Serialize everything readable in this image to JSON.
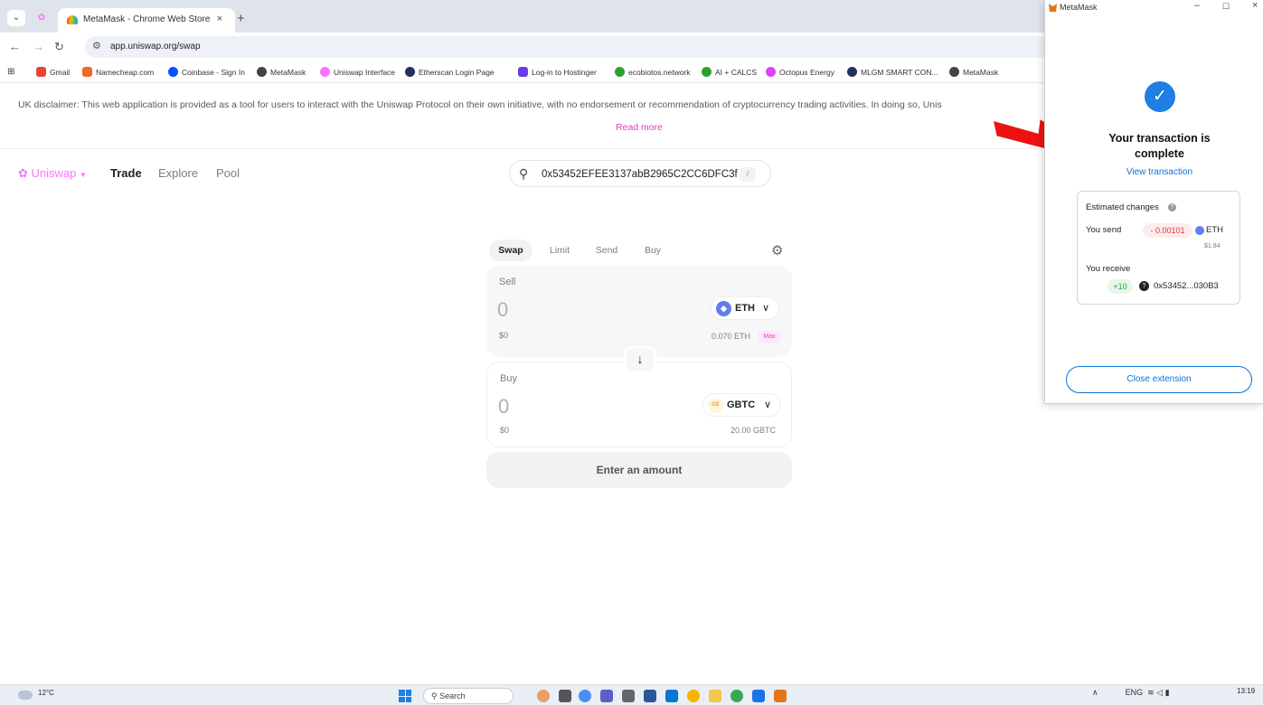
{
  "browser": {
    "tab_title": "MetaMask - Chrome Web Store",
    "tab_close": "×",
    "new_tab": "+",
    "url": "app.uniswap.org/swap",
    "bookmarks": [
      {
        "label": "Gmail",
        "color": "#ea4335"
      },
      {
        "label": "Namecheap.com",
        "color": "#f26722"
      },
      {
        "label": "Coinbase - Sign In",
        "color": "#0052ff"
      },
      {
        "label": "MetaMask",
        "color": "#444444"
      },
      {
        "label": "Uniswap Interface",
        "color": "#fc72ff"
      },
      {
        "label": "Etherscan Login Page",
        "color": "#21325b"
      },
      {
        "label": "Log-in to Hostinger",
        "color": "#673de6"
      },
      {
        "label": "ecobiotos.network",
        "color": "#2ca02c"
      },
      {
        "label": "AI + CALCS",
        "color": "#2ca02c"
      },
      {
        "label": "Octopus Energy",
        "color": "#e040fb"
      },
      {
        "label": "MLGM SMART CON...",
        "color": "#21325b"
      },
      {
        "label": "MetaMask",
        "color": "#444444"
      }
    ]
  },
  "page": {
    "disclaimer": "UK disclaimer: This web application is provided as a tool for users to interact with the Uniswap Protocol on their own initiative, with no endorsement or recommendation of cryptocurrency trading activities. In doing so, Unis",
    "read_more": "Read more",
    "nav": {
      "logo": "Uniswap",
      "links": [
        "Trade",
        "Explore",
        "Pool"
      ]
    },
    "search": {
      "value": "0x53452EFEE3137abB2965C2CC6DFC3f",
      "shortcut": "/"
    },
    "swap": {
      "tabs": [
        "Swap",
        "Limit",
        "Send",
        "Buy"
      ],
      "sell": {
        "label": "Sell",
        "amount": "0",
        "usd": "$0",
        "token": "ETH",
        "balance": "0.070 ETH",
        "max": "Max"
      },
      "buy": {
        "label": "Buy",
        "amount": "0",
        "usd": "$0",
        "token": "GBTC",
        "token_icon_text": "GE",
        "balance": "20.00 GBTC"
      },
      "cta": "Enter an amount"
    }
  },
  "metamask": {
    "window_title": "MetaMask",
    "heading": "Your transaction is complete",
    "view_transaction": "View transaction",
    "estimated_changes": "Estimated changes",
    "you_send": "You send",
    "send_amount": "- 0.00101",
    "send_token": "ETH",
    "send_usd": "$1.84",
    "you_receive": "You receive",
    "receive_amount": "+10",
    "receive_token": "0x53452...030B3",
    "close_button": "Close extension"
  },
  "taskbar": {
    "weather": "12°C",
    "search_placeholder": "Search",
    "language": "ENG",
    "time": "13:19"
  }
}
